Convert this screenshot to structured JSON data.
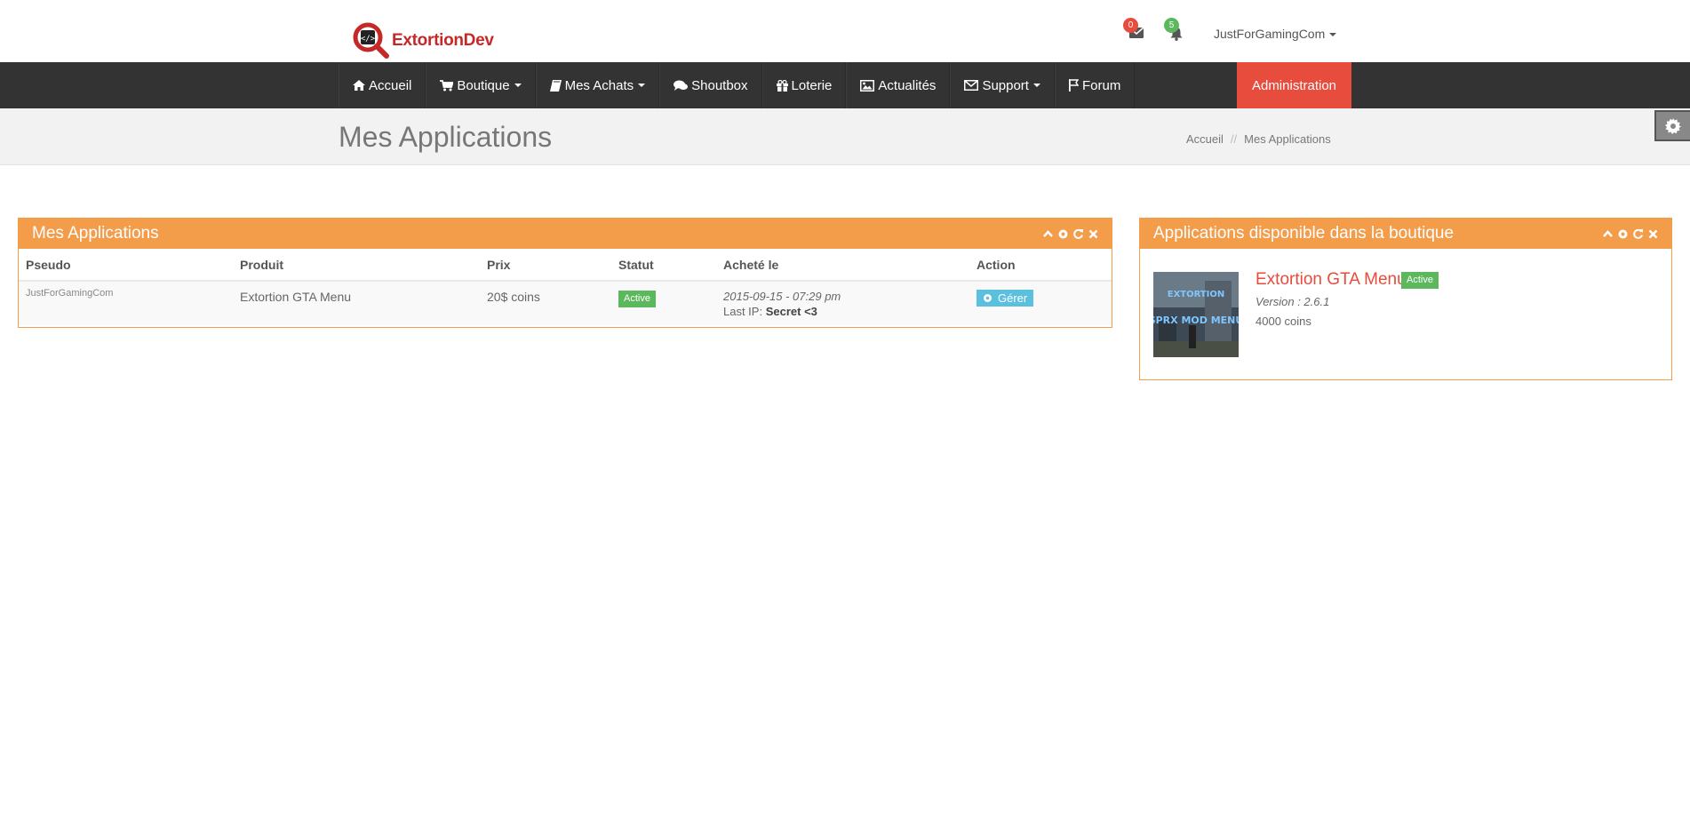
{
  "header": {
    "logo_text": "ExtortionDev",
    "messages_count": "0",
    "notifications_count": "5",
    "username": "JustForGamingCom"
  },
  "nav": {
    "items": [
      {
        "label": "Accueil",
        "icon": "home-icon"
      },
      {
        "label": "Boutique",
        "icon": "shopping-cart-icon",
        "dropdown": true
      },
      {
        "label": "Mes Achats",
        "icon": "book-icon",
        "dropdown": true
      },
      {
        "label": "Shoutbox",
        "icon": "comments-icon"
      },
      {
        "label": "Loterie",
        "icon": "gift-icon"
      },
      {
        "label": "Actualités",
        "icon": "picture-icon"
      },
      {
        "label": "Support",
        "icon": "envelope-icon",
        "dropdown": true
      },
      {
        "label": "Forum",
        "icon": "flag-icon"
      }
    ],
    "admin_label": "Administration"
  },
  "page": {
    "title": "Mes Applications",
    "breadcrumb": [
      "Accueil",
      "Mes Applications"
    ]
  },
  "apps_panel": {
    "title": "Mes Applications",
    "columns": [
      "Pseudo",
      "Produit",
      "Prix",
      "Statut",
      "Acheté le",
      "Action"
    ],
    "rows": [
      {
        "pseudo": "JustForGamingCom",
        "produit": "Extortion GTA Menu",
        "prix": "20$ coins",
        "statut": "Active",
        "date": "2015-09-15 - 07:29 pm",
        "last_ip_label": "Last IP:",
        "last_ip_value": "Secret <3",
        "action": "Gérer"
      }
    ]
  },
  "shop_panel": {
    "title": "Applications disponible dans la boutique",
    "product": {
      "name": "Extortion GTA Menu",
      "status": "Active",
      "version": "Version : 2.6.1",
      "price": "4000 coins",
      "thumb_text": "EXTORTION SPRX MOD MENU"
    }
  },
  "colors": {
    "navbar": "#333333",
    "admin": "#e74c3c",
    "panel": "#f39c4a",
    "active": "#5cb85c",
    "info": "#5bc0de",
    "accent_text": "#e74c3c"
  }
}
